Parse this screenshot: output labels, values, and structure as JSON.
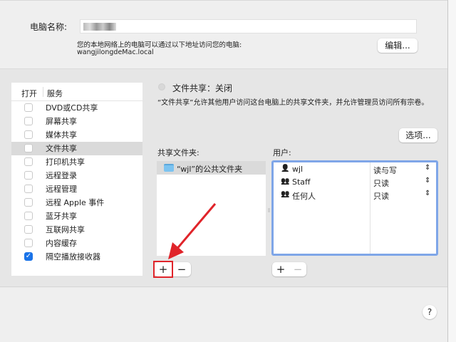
{
  "computer_name": {
    "label": "电脑名称:",
    "value": "",
    "hint": "您的本地网络上的电脑可以通过以下地址访问您的电脑:",
    "address": "wangjilongdeMac.local",
    "edit_button": "编辑..."
  },
  "services": {
    "col_on": "打开",
    "col_service": "服务",
    "items": [
      {
        "label": "DVD或CD共享",
        "checked": false
      },
      {
        "label": "屏幕共享",
        "checked": false
      },
      {
        "label": "媒体共享",
        "checked": false
      },
      {
        "label": "文件共享",
        "checked": false,
        "selected": true
      },
      {
        "label": "打印机共享",
        "checked": false
      },
      {
        "label": "远程登录",
        "checked": false
      },
      {
        "label": "远程管理",
        "checked": false
      },
      {
        "label": "远程 Apple 事件",
        "checked": false
      },
      {
        "label": "蓝牙共享",
        "checked": false
      },
      {
        "label": "互联网共享",
        "checked": false
      },
      {
        "label": "内容缓存",
        "checked": false
      },
      {
        "label": "隔空播放接收器",
        "checked": true
      }
    ]
  },
  "detail": {
    "status": "文件共享：关闭",
    "description": "“文件共享”允许其他用户访问这台电脑上的共享文件夹，并允许管理员访问所有宗卷。",
    "options_button": "选项...",
    "folders_label": "共享文件夹:",
    "users_label": "用户:",
    "folders": [
      "“wjl”的公共文件夹"
    ],
    "users": [
      {
        "name": "wjl",
        "icon": "user-icon",
        "permission": "读与写"
      },
      {
        "name": "Staff",
        "icon": "group-icon",
        "permission": "只读"
      },
      {
        "name": "任何人",
        "icon": "everyone-icon",
        "permission": "只读"
      }
    ],
    "add": "+",
    "remove": "−"
  },
  "help": "?",
  "accent": "#1a73e8",
  "annotation_color": "#e0242a"
}
